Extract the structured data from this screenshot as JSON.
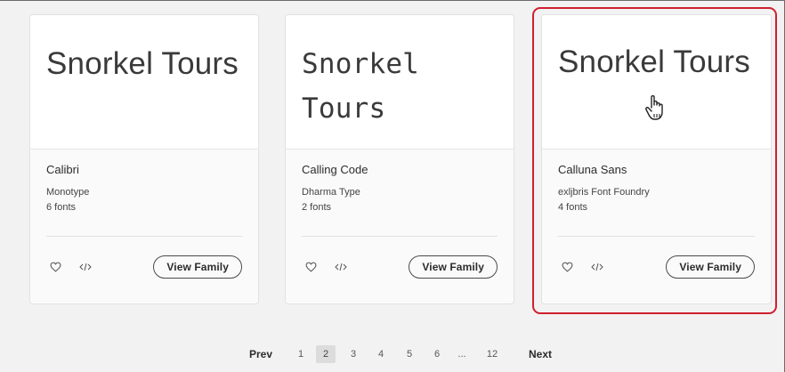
{
  "sample_text": "Snorkel Tours",
  "cards": [
    {
      "family": "Calibri",
      "foundry": "Monotype",
      "fonts_count": "6 fonts",
      "view_label": "View Family"
    },
    {
      "family": "Calling Code",
      "foundry": "Dharma Type",
      "fonts_count": "2 fonts",
      "view_label": "View Family"
    },
    {
      "family": "Calluna Sans",
      "foundry": "exljbris Font Foundry",
      "fonts_count": "4 fonts",
      "view_label": "View Family"
    }
  ],
  "icons": {
    "favorite": "heart-icon",
    "embed": "code-icon",
    "cursor": "hand-pointer-icon"
  },
  "pagination": {
    "prev": "Prev",
    "pages": [
      "1",
      "2",
      "3",
      "4",
      "5",
      "6",
      "...",
      "12"
    ],
    "current": "2",
    "next": "Next"
  },
  "colors": {
    "highlight": "#d01f2e",
    "background": "#f2f2f2",
    "card": "#fafafa",
    "preview": "#ffffff"
  }
}
